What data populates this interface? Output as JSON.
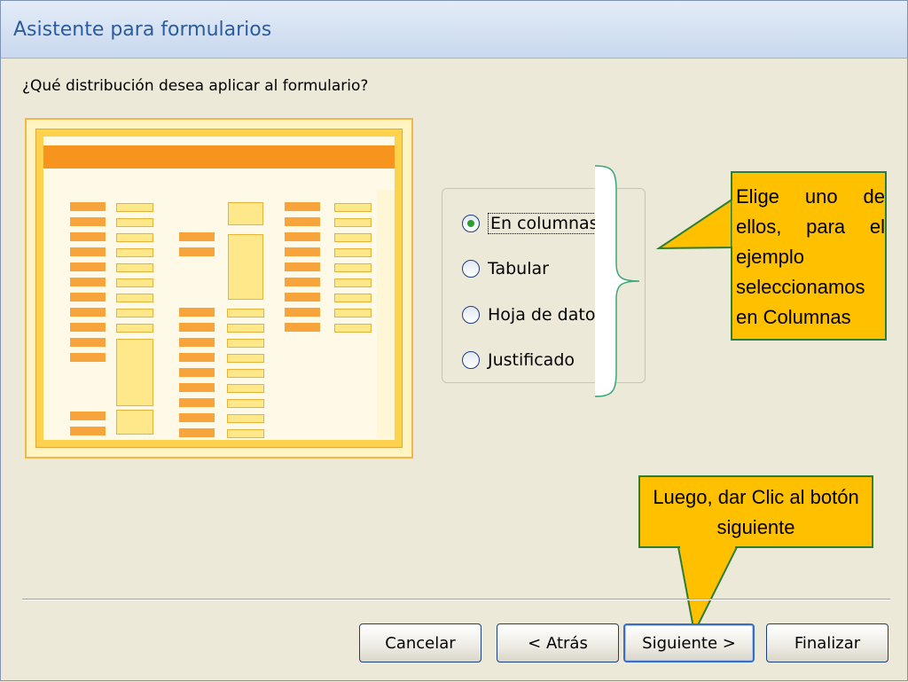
{
  "window": {
    "title": "Asistente para formularios"
  },
  "question": "¿Qué distribución desea aplicar al formulario?",
  "options": [
    {
      "label": "En columnas",
      "selected": true
    },
    {
      "label": "Tabular",
      "selected": false
    },
    {
      "label": "Hoja de datos",
      "selected": false
    },
    {
      "label": "Justificado",
      "selected": false
    }
  ],
  "callouts": {
    "choose": "Elige uno de ellos, para el ejemplo seleccionamos en Columnas",
    "next": "Luego, dar Clic al botón siguiente"
  },
  "buttons": {
    "cancel": "Cancelar",
    "back": "< Atrás",
    "next": "Siguiente >",
    "finish": "Finalizar"
  },
  "colors": {
    "accent": "#2B5C9E",
    "callout_fill": "#FFC000",
    "callout_border": "#2E7D32",
    "preview_orange": "#F7941D"
  }
}
